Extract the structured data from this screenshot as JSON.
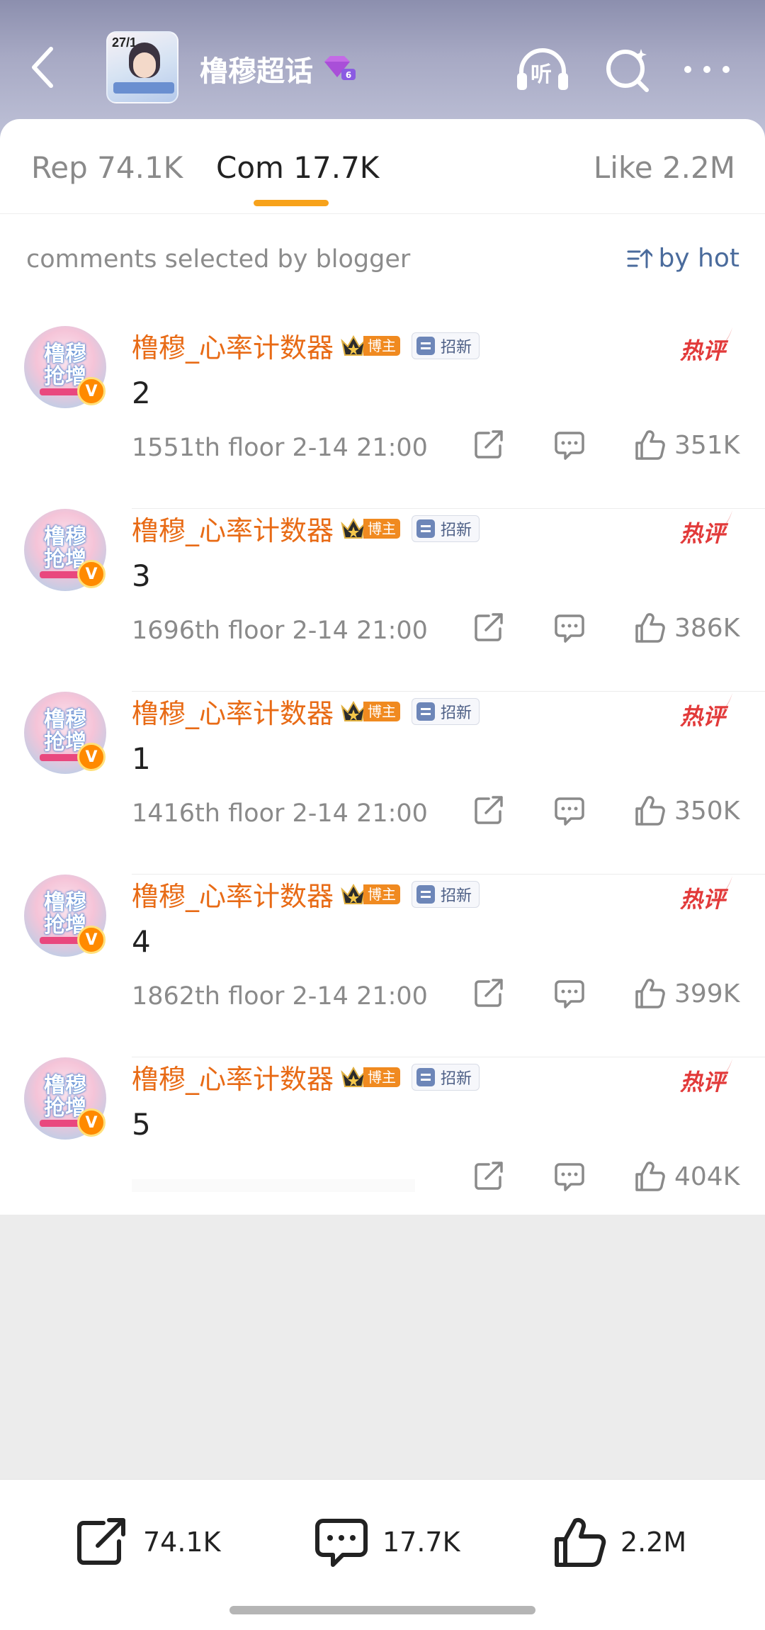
{
  "header": {
    "title": "橹穆超话",
    "thumb_number": "27/1",
    "listen_label": "听"
  },
  "tabs": [
    {
      "label": "Rep 74.1K"
    },
    {
      "label": "Com 17.7K"
    },
    {
      "label": "Like 2.2M"
    }
  ],
  "filter": {
    "label": "comments selected by blogger",
    "sort_label": "by hot"
  },
  "comments": [
    {
      "username": "橹穆_心率计数器",
      "blogger_tag": "博主",
      "recruit_tag": "招新",
      "hot_label": "热评",
      "text": "2",
      "floor": "1551th floor",
      "time": "2-14 21:00",
      "likes": "351K"
    },
    {
      "username": "橹穆_心率计数器",
      "blogger_tag": "博主",
      "recruit_tag": "招新",
      "hot_label": "热评",
      "text": "3",
      "floor": "1696th floor",
      "time": "2-14 21:00",
      "likes": "386K"
    },
    {
      "username": "橹穆_心率计数器",
      "blogger_tag": "博主",
      "recruit_tag": "招新",
      "hot_label": "热评",
      "text": "1",
      "floor": "1416th floor",
      "time": "2-14 21:00",
      "likes": "350K"
    },
    {
      "username": "橹穆_心率计数器",
      "blogger_tag": "博主",
      "recruit_tag": "招新",
      "hot_label": "热评",
      "text": "4",
      "floor": "1862th floor",
      "time": "2-14 21:00",
      "likes": "399K"
    },
    {
      "username": "橹穆_心率计数器",
      "blogger_tag": "博主",
      "recruit_tag": "招新",
      "hot_label": "热评",
      "text": "5",
      "floor": "",
      "time": "",
      "likes": "404K"
    }
  ],
  "avatar_text": "橹穆抢增",
  "bottom_bar": {
    "share_count": "74.1K",
    "comment_count": "17.7K",
    "like_count": "2.2M"
  },
  "colors": {
    "accent": "#f7a21b",
    "username": "#e86b16",
    "hot": "#e23a3a",
    "sort": "#4a6b9c"
  }
}
